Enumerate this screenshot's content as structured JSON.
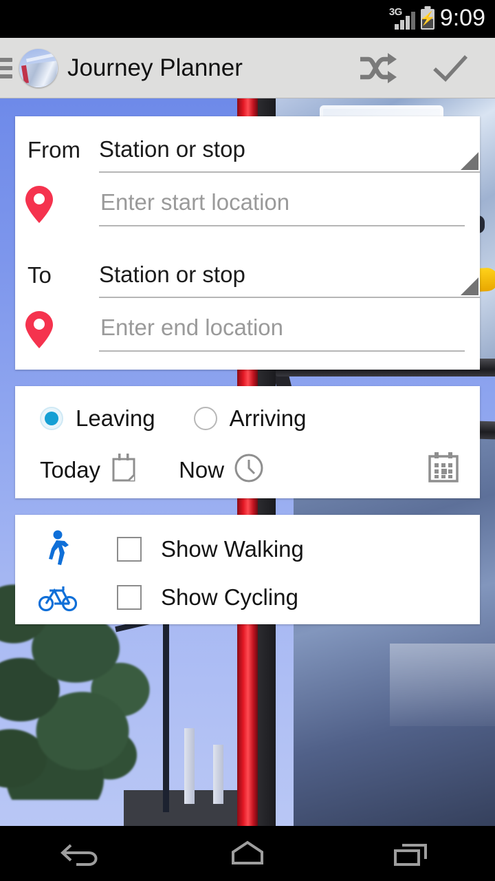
{
  "status_bar": {
    "network": "3G",
    "time": "9:09",
    "battery_icon": "battery-charging-icon",
    "signal_icon": "signal-bars-icon"
  },
  "app_bar": {
    "menu_icon": "hamburger-menu-icon",
    "app_icon": "journey-planner-app-icon",
    "title": "Journey Planner",
    "swap_icon": "swap-shuffle-icon",
    "confirm_icon": "checkmark-icon"
  },
  "locations": {
    "from": {
      "label": "From",
      "spinner_value": "Station or stop",
      "spinner_arrow_icon": "dropdown-triangle-icon",
      "pin_icon": "map-pin-icon",
      "input_value": "",
      "input_placeholder": "Enter start location"
    },
    "to": {
      "label": "To",
      "spinner_value": "Station or stop",
      "spinner_arrow_icon": "dropdown-triangle-icon",
      "pin_icon": "map-pin-icon",
      "input_value": "",
      "input_placeholder": "Enter end location"
    }
  },
  "time_options": {
    "leaving_label": "Leaving",
    "arriving_label": "Arriving",
    "selected": "Leaving",
    "date_label": "Today",
    "date_icon": "calendar-page-icon",
    "time_label": "Now",
    "time_icon": "clock-icon",
    "calendar_button_icon": "calendar-grid-icon"
  },
  "modes": {
    "walking": {
      "icon": "pedestrian-walking-icon",
      "label": "Show Walking",
      "checked": false
    },
    "cycling": {
      "icon": "bicycle-icon",
      "label": "Show Cycling",
      "checked": false
    }
  },
  "nav_bar": {
    "back_icon": "back-arrow-icon",
    "home_icon": "home-icon",
    "recents_icon": "recent-apps-icon"
  },
  "colors": {
    "accent_blue": "#159fd4",
    "pin_red": "#F5334E",
    "mode_blue": "#0F6FD8",
    "app_bar_bg": "#dededd",
    "sky_blue": "#6e8ae9"
  }
}
